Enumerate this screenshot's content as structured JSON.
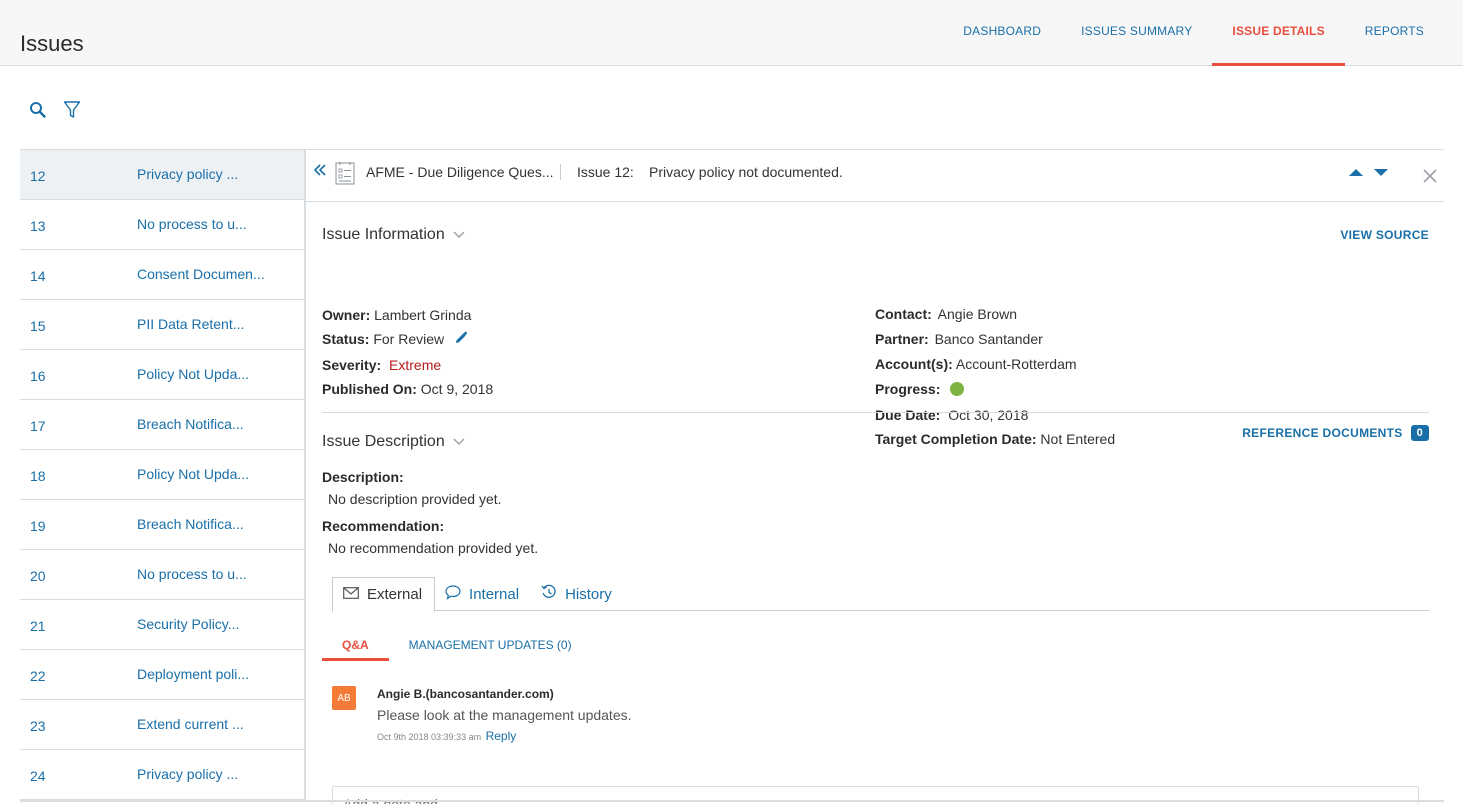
{
  "app": {
    "title": "Issues"
  },
  "nav": {
    "tabs": [
      {
        "label": "DASHBOARD",
        "active": false
      },
      {
        "label": "ISSUES SUMMARY",
        "active": false
      },
      {
        "label": "ISSUE DETAILS",
        "active": true
      },
      {
        "label": "REPORTS",
        "active": false
      }
    ]
  },
  "toolbar": {
    "icons": [
      "search-icon",
      "filter-icon"
    ]
  },
  "issue_list": [
    {
      "num": "12",
      "title": "Privacy policy ...",
      "selected": true
    },
    {
      "num": "13",
      "title": "No process to u..."
    },
    {
      "num": "14",
      "title": "Consent Documen..."
    },
    {
      "num": "15",
      "title": "PII Data Retent..."
    },
    {
      "num": "16",
      "title": "Policy Not Upda..."
    },
    {
      "num": "17",
      "title": "Breach Notifica..."
    },
    {
      "num": "18",
      "title": "Policy Not Upda..."
    },
    {
      "num": "19",
      "title": "Breach Notifica..."
    },
    {
      "num": "20",
      "title": "No process to u..."
    },
    {
      "num": "21",
      "title": "Security Policy..."
    },
    {
      "num": "22",
      "title": "Deployment poli..."
    },
    {
      "num": "23",
      "title": "Extend current ..."
    },
    {
      "num": "24",
      "title": "Privacy policy ..."
    }
  ],
  "detail": {
    "source_title": "AFME - Due Diligence Ques...",
    "issue_label": "Issue 12:",
    "issue_title": "Privacy policy not documented.",
    "info": {
      "section_title": "Issue Information",
      "view_source": "VIEW SOURCE",
      "owner_label": "Owner:",
      "owner": "Lambert Grinda",
      "status_label": "Status:",
      "status": "For Review",
      "severity_label": "Severity:",
      "severity": "Extreme",
      "published_label": "Published On:",
      "published": "Oct 9, 2018",
      "contact_label": "Contact:",
      "contact": "Angie Brown",
      "partner_label": "Partner:",
      "partner": "Banco Santander",
      "accounts_label": "Account(s):",
      "accounts": "Account-Rotterdam",
      "progress_label": "Progress:",
      "progress_color": "#7cb342",
      "due_label": "Due Date:",
      "due": "Oct 30, 2018",
      "target_label": "Target Completion Date:",
      "target": "Not Entered"
    },
    "description": {
      "section_title": "Issue Description",
      "ref_docs_label": "REFERENCE DOCUMENTS",
      "ref_docs_count": "0",
      "description_label": "Description:",
      "description": "No description provided yet.",
      "recommendation_label": "Recommendation:",
      "recommendation": "No recommendation provided yet."
    },
    "comm_tabs": [
      {
        "label": "External",
        "icon": "envelope-icon",
        "active": true
      },
      {
        "label": "Internal",
        "icon": "chat-bubble-icon",
        "active": false
      },
      {
        "label": "History",
        "icon": "history-icon",
        "active": false
      }
    ],
    "sub_tabs": [
      {
        "label": "Q&A",
        "active": true
      },
      {
        "label": "MANAGEMENT UPDATES (0)",
        "active": false
      }
    ],
    "comments": [
      {
        "initials": "AB",
        "author": "Angie B.(bancosantander.com)",
        "body": "Please look at the management updates.",
        "timestamp": "Oct 9th 2018 03:39:33 am",
        "reply_label": "Reply"
      }
    ],
    "reply_placeholder": "Add a note and..."
  },
  "colors": {
    "accent": "#1a6fa8",
    "active_tab": "#e84f3d",
    "severity": "#b71c1c",
    "avatar": "#f47a37"
  }
}
